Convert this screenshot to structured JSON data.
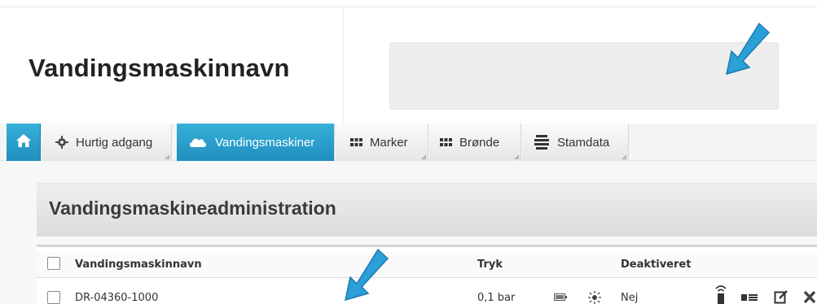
{
  "field": {
    "label": "Vandingsmaskinnavn",
    "value": ""
  },
  "nav": {
    "home_icon": "home-icon",
    "tabs": [
      {
        "label": "Hurtig adgang",
        "icon": "gear-icon",
        "active": false
      },
      {
        "label": "Vandingsmaskiner",
        "icon": "cloud-icon",
        "active": true
      },
      {
        "label": "Marker",
        "icon": "grid-icon",
        "active": false
      },
      {
        "label": "Brønde",
        "icon": "grid-icon",
        "active": false
      },
      {
        "label": "Stamdata",
        "icon": "stack-icon",
        "active": false
      }
    ]
  },
  "panel": {
    "title": "Vandingsmaskineadministration"
  },
  "table": {
    "columns": [
      "Vandingsmaskinnavn",
      "Tryk",
      "Deaktiveret"
    ],
    "rows": [
      {
        "name": "DR-04360-1000",
        "tryk": "0,1 bar",
        "deaktiveret": "Nej"
      }
    ]
  },
  "colors": {
    "accent": "#2a9fd0",
    "arrow": "#2a9fd8"
  }
}
